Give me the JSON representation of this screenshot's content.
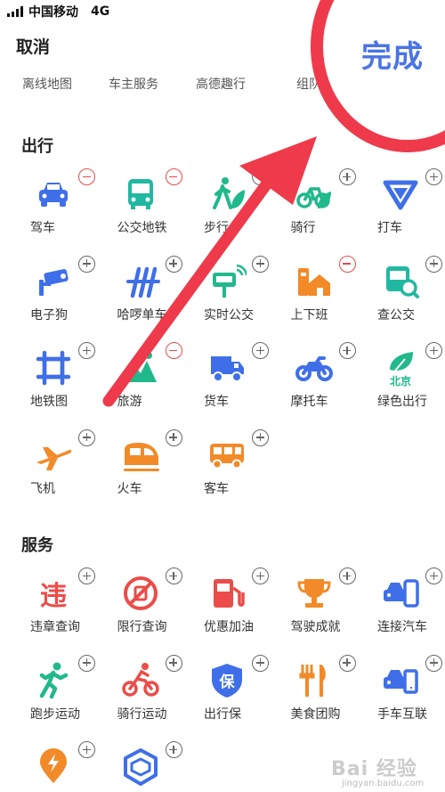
{
  "status_bar": {
    "carrier": "中国移动",
    "network": "4G"
  },
  "header": {
    "cancel_label": "取消",
    "done_label": "完成"
  },
  "tabs": [
    "离线地图",
    "车主服务",
    "高德趣行",
    "组队"
  ],
  "sections": [
    {
      "title": "出行",
      "items": [
        {
          "label": "驾车",
          "icon": "car-icon",
          "action": "remove",
          "color": "#3f6fe8"
        },
        {
          "label": "公交地铁",
          "icon": "bus-icon",
          "action": "remove",
          "color": "#21b8a2"
        },
        {
          "label": "步行",
          "icon": "walk-icon",
          "action": "add",
          "color": "#21b88c"
        },
        {
          "label": "骑行",
          "icon": "bike-icon",
          "action": "add",
          "color": "#21b88c"
        },
        {
          "label": "打车",
          "icon": "taxi-icon",
          "action": "add",
          "color": "#3f6fe8"
        },
        {
          "label": "电子狗",
          "icon": "camera-icon",
          "action": "add",
          "color": "#3f6fe8"
        },
        {
          "label": "哈啰单车",
          "icon": "hellobike-icon",
          "action": "add",
          "color": "#3f6fe8"
        },
        {
          "label": "实时公交",
          "icon": "realtime-bus-icon",
          "action": "add",
          "color": "#21b88c"
        },
        {
          "label": "上下班",
          "icon": "commute-icon",
          "action": "remove",
          "color": "#f28a28"
        },
        {
          "label": "查公交",
          "icon": "bus-search-icon",
          "action": "add",
          "color": "#21b8a2"
        },
        {
          "label": "地铁图",
          "icon": "subway-map-icon",
          "action": "add",
          "color": "#3f6fe8"
        },
        {
          "label": "旅游",
          "icon": "travel-icon",
          "action": "remove",
          "color": "#21b88c"
        },
        {
          "label": "货车",
          "icon": "truck-icon",
          "action": "add",
          "color": "#3f6fe8"
        },
        {
          "label": "摩托车",
          "icon": "motorcycle-icon",
          "action": "add",
          "color": "#3f6fe8"
        },
        {
          "label": "绿色出行",
          "icon": "green-travel-icon",
          "action": "add",
          "color": "#21b88c",
          "badge_text": "北京"
        },
        {
          "label": "飞机",
          "icon": "plane-icon",
          "action": "add",
          "color": "#f28a28"
        },
        {
          "label": "火车",
          "icon": "train-icon",
          "action": "add",
          "color": "#f28a28"
        },
        {
          "label": "客车",
          "icon": "coach-icon",
          "action": "add",
          "color": "#f28a28"
        }
      ]
    },
    {
      "title": "服务",
      "items": [
        {
          "label": "违章查询",
          "icon": "violation-icon",
          "action": "add",
          "color": "#ec4c48",
          "glyph": "违"
        },
        {
          "label": "限行查询",
          "icon": "restriction-icon",
          "action": "add",
          "color": "#ec4c48"
        },
        {
          "label": "优惠加油",
          "icon": "fuel-icon",
          "action": "add",
          "color": "#ec4c48"
        },
        {
          "label": "驾驶成就",
          "icon": "trophy-icon",
          "action": "add",
          "color": "#f28a28"
        },
        {
          "label": "连接汽车",
          "icon": "car-connect-icon",
          "action": "add",
          "color": "#3f6fe8"
        },
        {
          "label": "跑步运动",
          "icon": "run-icon",
          "action": "add",
          "color": "#21b88c"
        },
        {
          "label": "骑行运动",
          "icon": "cycling-icon",
          "action": "add",
          "color": "#ec4c48"
        },
        {
          "label": "出行保",
          "icon": "insurance-icon",
          "action": "add",
          "color": "#3f6fe8",
          "glyph": "保"
        },
        {
          "label": "美食团购",
          "icon": "food-icon",
          "action": "add",
          "color": "#f28a28"
        },
        {
          "label": "手车互联",
          "icon": "phone-car-icon",
          "action": "add",
          "color": "#3f6fe8"
        },
        {
          "label": "",
          "icon": "charging-pin-icon",
          "action": "add",
          "color": "#f28a28"
        },
        {
          "label": "",
          "icon": "cube-icon",
          "action": "add",
          "color": "#3f6fe8"
        }
      ]
    }
  ],
  "overlay": {
    "circle_color": "#ee3a4a",
    "arrow_color": "#ee3a4a"
  },
  "watermark": {
    "brand": "Bai 经验",
    "url": "jingyan.baidu.com"
  }
}
